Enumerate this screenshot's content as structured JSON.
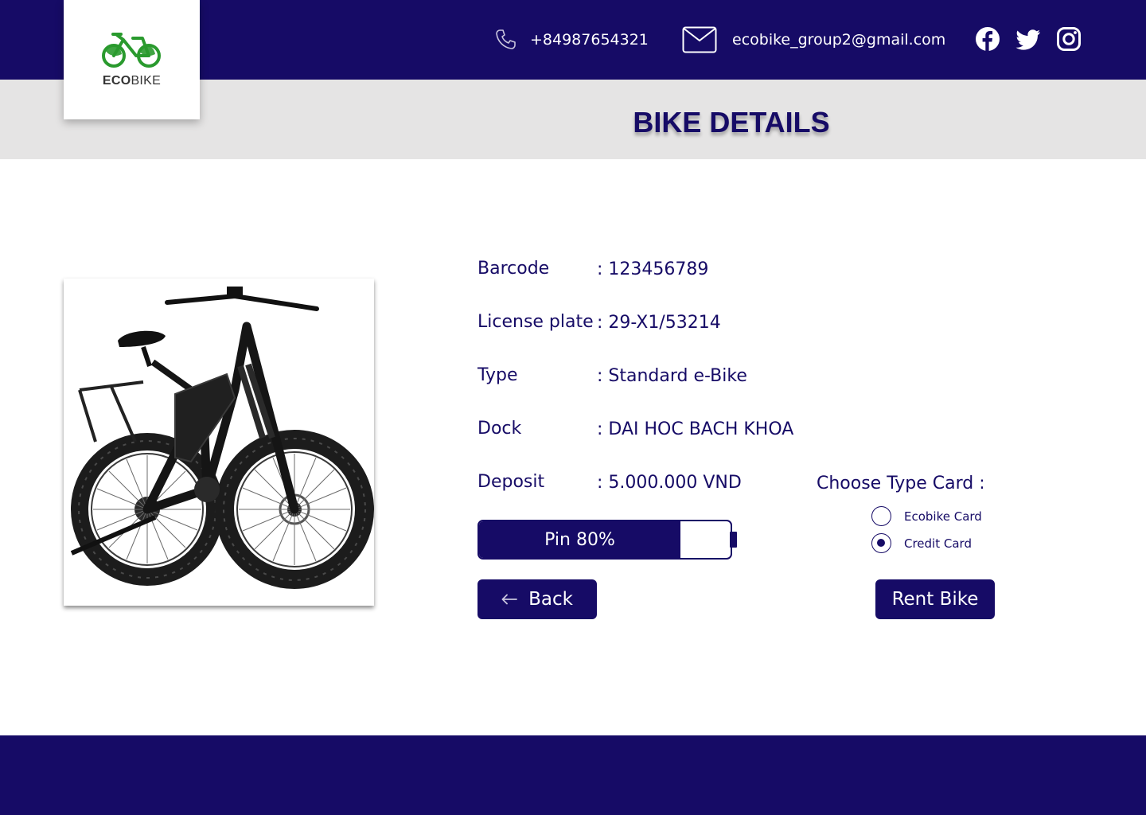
{
  "brand": {
    "logo_prefix": "ECO",
    "logo_suffix": "BIKE",
    "primary_color": "#160b66",
    "accent_color": "#2a9a2e"
  },
  "header": {
    "phone": "+84987654321",
    "email": "ecobike_group2@gmail.com",
    "icons": [
      "phone-icon",
      "mail-icon",
      "facebook-icon",
      "twitter-icon",
      "instagram-icon"
    ]
  },
  "page": {
    "title": "BIKE DETAILS"
  },
  "details": [
    {
      "label": "Barcode",
      "value": ": 123456789"
    },
    {
      "label": "License plate",
      "value": ": 29-X1/53214"
    },
    {
      "label": "Type",
      "value": ": Standard e-Bike"
    },
    {
      "label": "Dock",
      "value": ": DAI HOC BACH KHOA"
    },
    {
      "label": "Deposit",
      "value": ": 5.000.000 VND"
    }
  ],
  "battery": {
    "label": "Pin 80%",
    "level": 0.8
  },
  "card_choice": {
    "title": "Choose Type Card :",
    "options": [
      {
        "label": "Ecobike Card",
        "selected": false
      },
      {
        "label": "Credit Card",
        "selected": true
      }
    ]
  },
  "buttons": {
    "back": "Back",
    "rent": "Rent Bike"
  }
}
